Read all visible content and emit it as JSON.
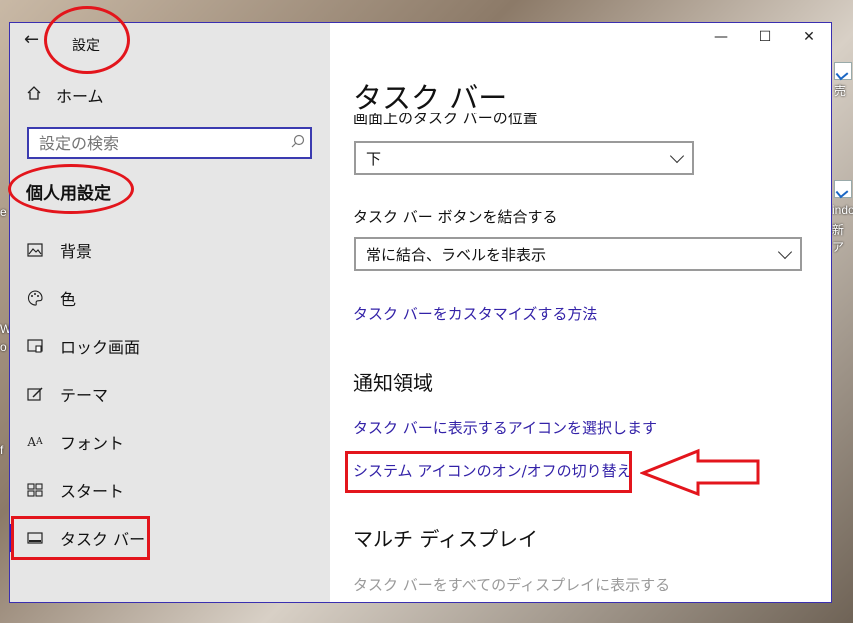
{
  "window": {
    "title": "設定",
    "back_icon": "←",
    "controls": {
      "minimize": "—",
      "maximize": "☐",
      "close": "✕"
    }
  },
  "sidebar": {
    "home_label": "ホーム",
    "search_placeholder": "設定の検索",
    "section_title": "個人用設定",
    "items": [
      {
        "label": "背景",
        "icon": "image-icon"
      },
      {
        "label": "色",
        "icon": "palette-icon"
      },
      {
        "label": "ロック画面",
        "icon": "lock-screen-icon"
      },
      {
        "label": "テーマ",
        "icon": "theme-icon"
      },
      {
        "label": "フォント",
        "icon": "font-icon"
      },
      {
        "label": "スタート",
        "icon": "start-icon"
      },
      {
        "label": "タスク バー",
        "icon": "taskbar-icon",
        "active": true
      }
    ]
  },
  "main": {
    "page_title": "タスク バー",
    "position_label": "画面上のタスク バーの位置",
    "position_value": "下",
    "combine_label": "タスク バー ボタンを結合する",
    "combine_value": "常に結合、ラベルを非表示",
    "customize_link": "タスク バーをカスタマイズする方法",
    "notification_heading": "通知領域",
    "select_icons_link": "タスク バーに表示するアイコンを選択します",
    "system_icons_link": "システム アイコンのオン/オフの切り替え",
    "multi_display_heading": "マルチ ディスプレイ",
    "show_all_displays_label": "タスク バーをすべてのディスプレイに表示する"
  },
  "desktop": {
    "right_texts": [
      "売",
      "indo",
      "新ア"
    ],
    "left_texts": [
      "e",
      "W",
      "o",
      "f"
    ]
  },
  "colors": {
    "accent": "#2c1fc0",
    "link": "#3322a8",
    "annotation": "#e3151c"
  }
}
